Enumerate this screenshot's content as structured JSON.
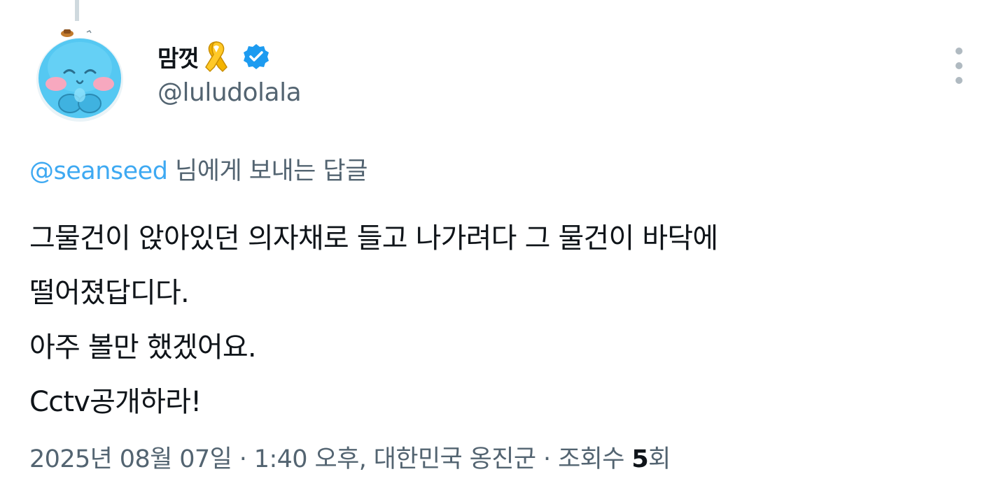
{
  "author": {
    "display_name": "맘껏",
    "handle": "@luludolala",
    "badges": [
      "yellow-ribbon-icon",
      "verified-badge-icon"
    ]
  },
  "reply_context": {
    "mention": "@seanseed",
    "suffix": " 님에게 보내는 답글"
  },
  "tweet": {
    "lines": [
      "그물건이 앉아있던 의자채로 들고 나가려다 그 물건이 바닥에",
      "떨어졌답디다.",
      "아주 볼만 했겠어요.",
      "Cctv공개하라!"
    ]
  },
  "meta": {
    "date": "2025년 08월 07일",
    "sep1": " · ",
    "time_location": "1:40 오후, 대한민국 옹진군",
    "sep2": " · ",
    "views_label": "조회수 ",
    "views_count": "5",
    "views_suffix": "회"
  },
  "colors": {
    "text_primary": "#0f1419",
    "text_secondary": "#536471",
    "link": "#1d9bf0",
    "verified": "#1d9bf0",
    "ribbon": "#f2b705"
  }
}
